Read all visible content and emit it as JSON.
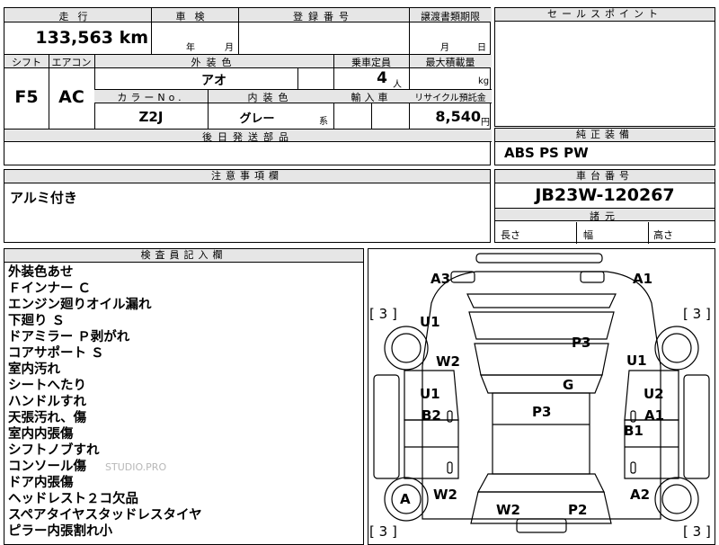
{
  "main_form": {
    "mileage_header": "走行",
    "mileage_value": "133,563",
    "mileage_unit": "km",
    "inspection_header": "車検",
    "inspection_year_unit": "年",
    "inspection_month_unit": "月",
    "registration_header": "登録番号",
    "transfer_header": "譲渡書類期限",
    "transfer_month_unit": "月",
    "transfer_day_unit": "日",
    "shift_header": "シフト",
    "shift_value": "F5",
    "aircon_header": "エアコン",
    "aircon_value": "AC",
    "exterior_color_header": "外装色",
    "exterior_color_value": "アオ",
    "capacity_header": "乗車定員",
    "capacity_value": "4",
    "capacity_unit": "人",
    "max_load_header": "最大積載量",
    "max_load_unit": "kg",
    "color_no_header": "カラーNo.",
    "color_no_value": "Z2J",
    "interior_color_header": "内装色",
    "interior_color_value": "グレー",
    "interior_color_suffix": "系",
    "import_header": "輸入車",
    "recycle_header": "リサイクル預託金",
    "recycle_value": "8,540",
    "recycle_unit": "円",
    "later_parts_header": "後日発送部品"
  },
  "sales_points": {
    "header": "セールスポイント"
  },
  "genuine_equipment": {
    "header": "純正装備",
    "value": "ABS PS PW"
  },
  "caution": {
    "header": "注意事項欄",
    "value": "アルミ付き"
  },
  "chassis": {
    "header": "車台番号",
    "value": "JB23W-120267",
    "dims_header": "諸元",
    "length_label": "長さ",
    "width_label": "幅",
    "height_label": "高さ"
  },
  "inspector_notes": {
    "header": "検査員記入欄",
    "lines": [
      "外装色あせ",
      "Ｆインナー Ｃ",
      "エンジン廻りオイル漏れ",
      "下廻り Ｓ",
      "ドアミラー Ｐ剥がれ",
      "コアサポート Ｓ",
      "室内汚れ",
      "シートへたり",
      "ハンドルすれ",
      "天張汚れ、傷",
      "室内内張傷",
      "シフトノブすれ",
      "コンソール傷",
      "ドア内張傷",
      "ヘッドレスト２コ欠品",
      "スペアタイヤスタッドレスタイヤ",
      "ピラー内張割れ小"
    ]
  },
  "diagram": {
    "watermark": "STUDIO.PRO",
    "labels": [
      "A3",
      "A1",
      "U1",
      "P3",
      "W2",
      "U1",
      "G",
      "U1",
      "U2",
      "B2",
      "P3",
      "A1",
      "B1",
      "A",
      "W2",
      "A2",
      "W2",
      "P2"
    ],
    "bracket_values": [
      "3",
      "3",
      "3",
      "3"
    ]
  }
}
